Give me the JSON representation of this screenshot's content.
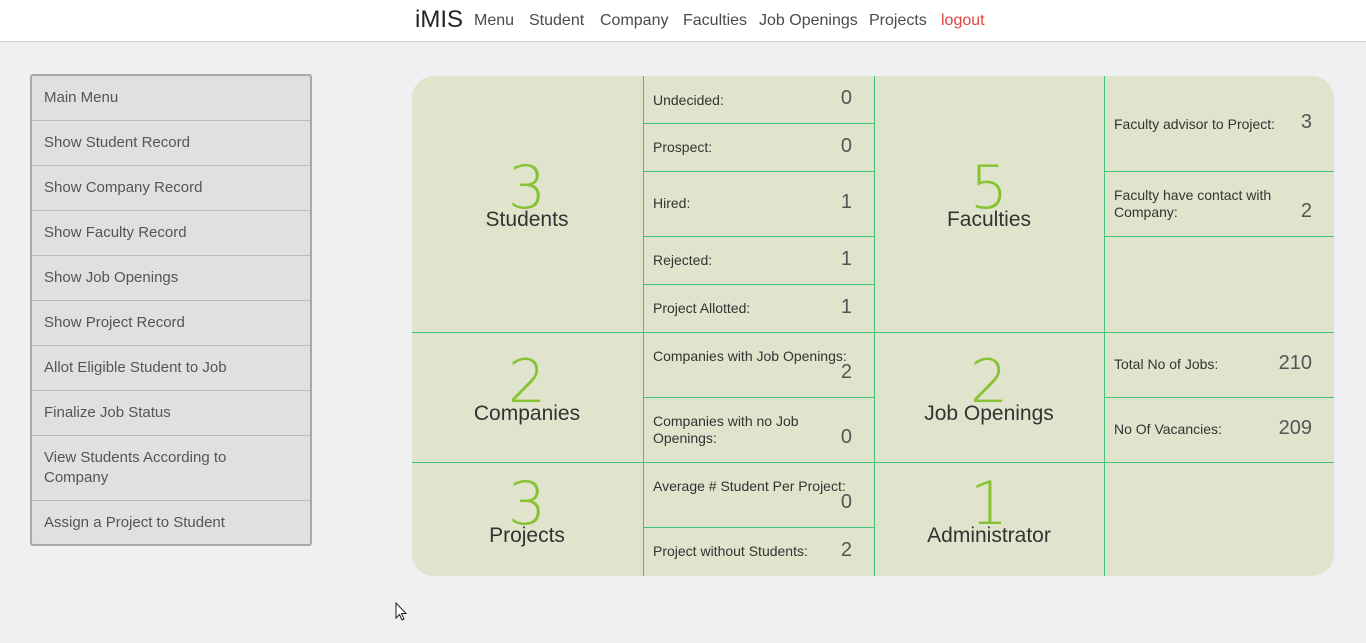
{
  "nav": {
    "brand": "iMIS",
    "links": [
      "Menu",
      "Student",
      "Company",
      "Faculties",
      "Job Openings",
      "Projects",
      "logout"
    ]
  },
  "sidebar": {
    "items": [
      "Main Menu",
      "Show Student Record",
      "Show Company Record",
      "Show Faculty Record",
      "Show Job Openings",
      "Show Project Record",
      "Allot Eligible Student to Job",
      "Finalize Job Status",
      "View Students According to Company",
      "Assign a Project to Student"
    ]
  },
  "dashboard": {
    "students": {
      "count": "3",
      "label": "Students",
      "stats": [
        {
          "label": "Undecided:",
          "value": "0"
        },
        {
          "label": "Prospect:",
          "value": "0"
        },
        {
          "label": "Hired:",
          "value": "1"
        },
        {
          "label": "Rejected:",
          "value": "1"
        },
        {
          "label": "Project Allotted:",
          "value": "1"
        }
      ]
    },
    "faculties": {
      "count": "5",
      "label": "Faculties",
      "stats": [
        {
          "label": "Faculty advisor to Project:",
          "value": "3"
        },
        {
          "label": "Faculty have contact with Company:",
          "value": "2"
        }
      ]
    },
    "companies": {
      "count": "2",
      "label": "Companies",
      "stats": [
        {
          "label": "Companies with Job Openings:",
          "value": "2"
        },
        {
          "label": "Companies with no Job Openings:",
          "value": "0"
        }
      ]
    },
    "jobs": {
      "count": "2",
      "label": "Job Openings",
      "stats": [
        {
          "label": "Total No of Jobs:",
          "value": "210"
        },
        {
          "label": "No Of Vacancies:",
          "value": "209"
        }
      ]
    },
    "projects": {
      "count": "3",
      "label": "Projects",
      "stats": [
        {
          "label": "Average # Student Per Project:",
          "value": "0"
        },
        {
          "label": "Project without Students:",
          "value": "2"
        }
      ]
    },
    "admin": {
      "count": "1",
      "label": "Administrator"
    }
  },
  "colors": {
    "accent": "#86c232",
    "divider": "#3fc47a",
    "panel": "#e0e4cd",
    "logout": "#e0453d"
  }
}
